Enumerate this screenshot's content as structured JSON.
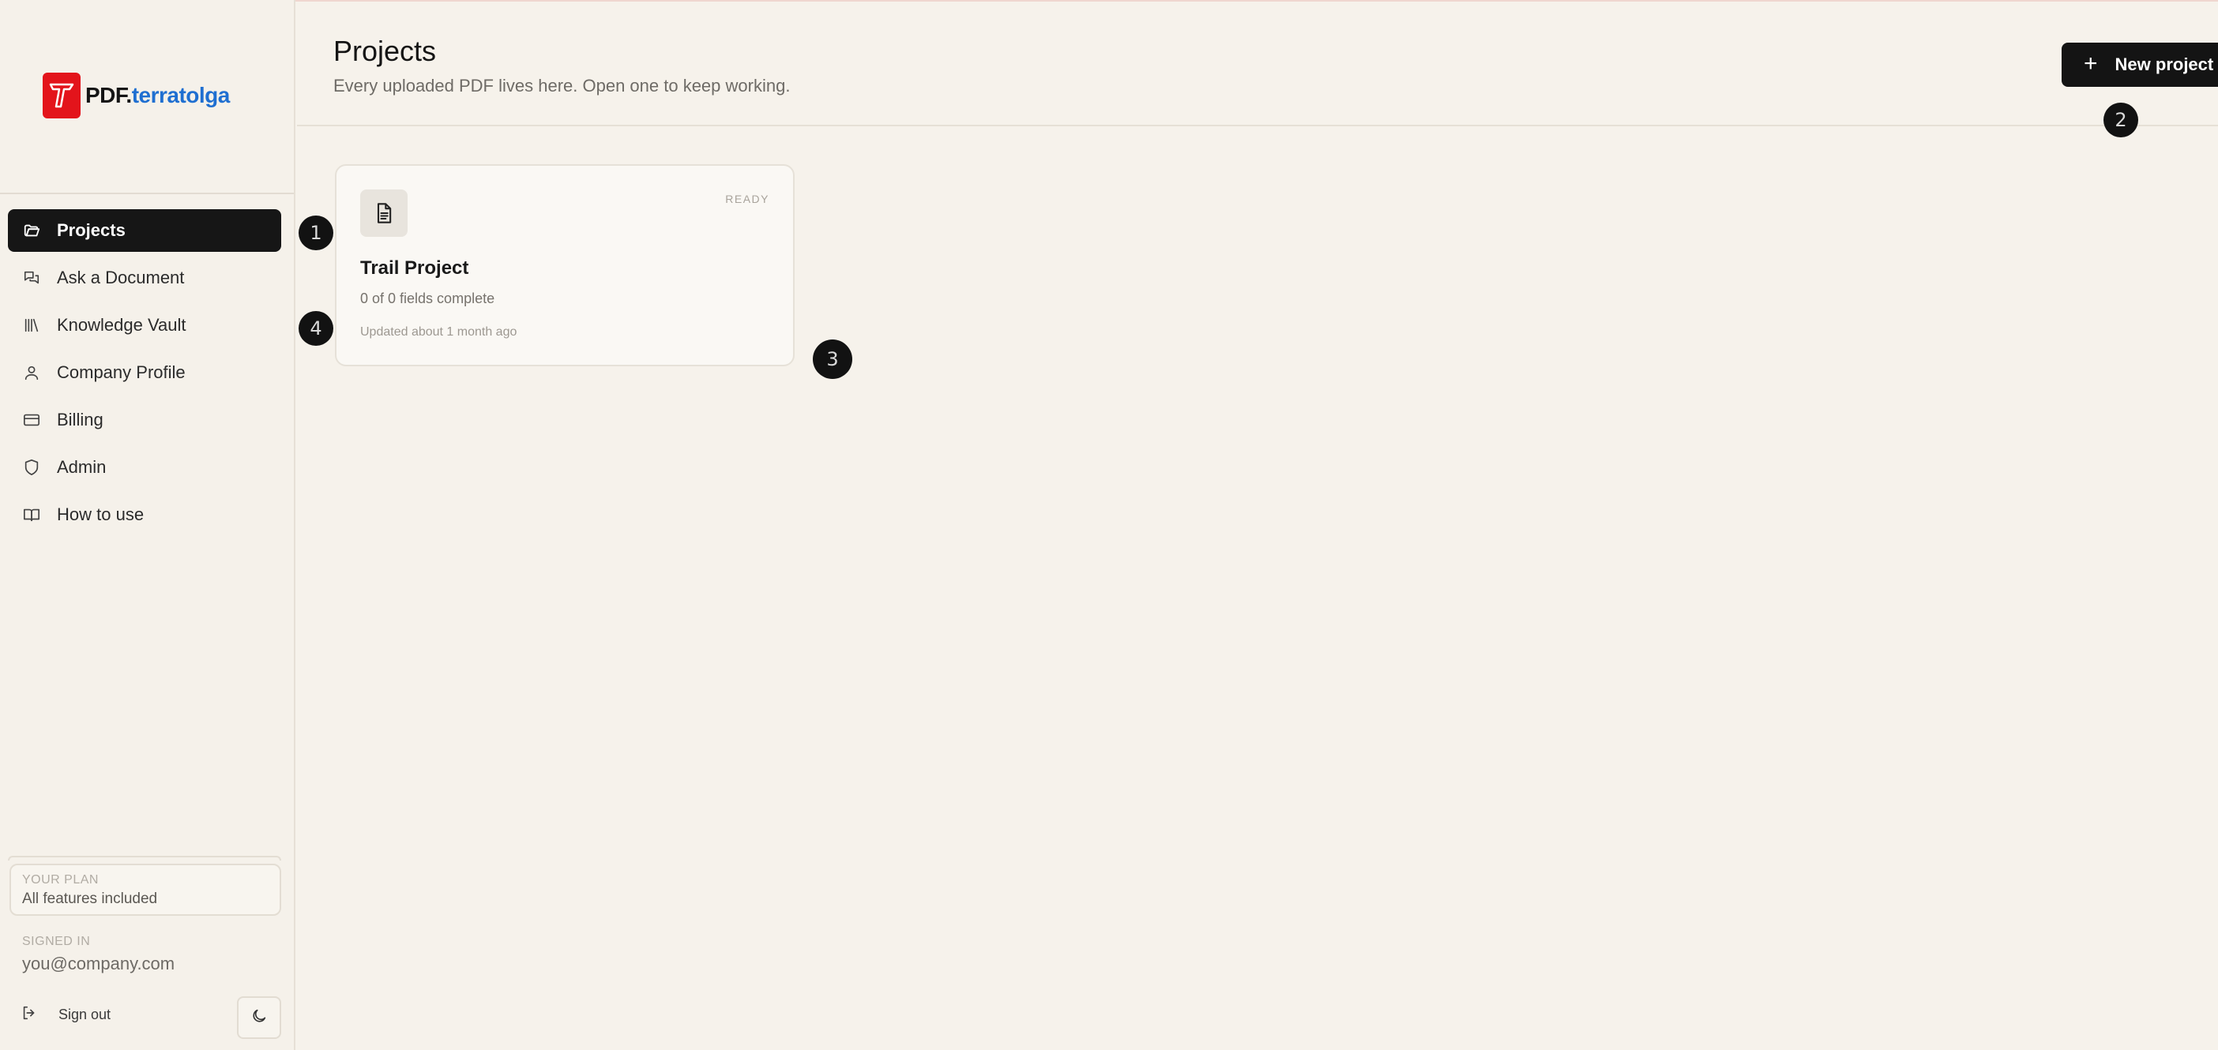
{
  "brand": {
    "name_part1": "PDF.",
    "name_part2": "terratolga",
    "accent_color": "#e3141b",
    "link_color": "#1f6fd1"
  },
  "sidebar": {
    "items": [
      {
        "label": "Projects",
        "icon": "folder-open-icon",
        "active": true
      },
      {
        "label": "Ask a Document",
        "icon": "chat-bubbles-icon",
        "active": false
      },
      {
        "label": "Knowledge Vault",
        "icon": "library-icon",
        "active": false
      },
      {
        "label": "Company Profile",
        "icon": "user-icon",
        "active": false
      },
      {
        "label": "Billing",
        "icon": "credit-card-icon",
        "active": false
      },
      {
        "label": "Admin",
        "icon": "shield-icon",
        "active": false
      },
      {
        "label": "How to use",
        "icon": "book-open-icon",
        "active": false
      }
    ],
    "plan": {
      "caption": "YOUR PLAN",
      "value": "All features included"
    },
    "signed_in": {
      "caption": "SIGNED IN",
      "email": "you@company.com"
    },
    "sign_out_label": "Sign out",
    "theme_toggle_icon": "moon-icon"
  },
  "header": {
    "title": "Projects",
    "subtitle": "Every uploaded PDF lives here. Open one to keep working.",
    "new_project_label": "New project",
    "new_project_icon": "plus-icon"
  },
  "projects": [
    {
      "title": "Trail Project",
      "status": "READY",
      "fields": "0 of 0 fields complete",
      "updated": "Updated about 1 month ago",
      "icon": "document-icon"
    }
  ],
  "markers": [
    "1",
    "2",
    "3",
    "4"
  ]
}
